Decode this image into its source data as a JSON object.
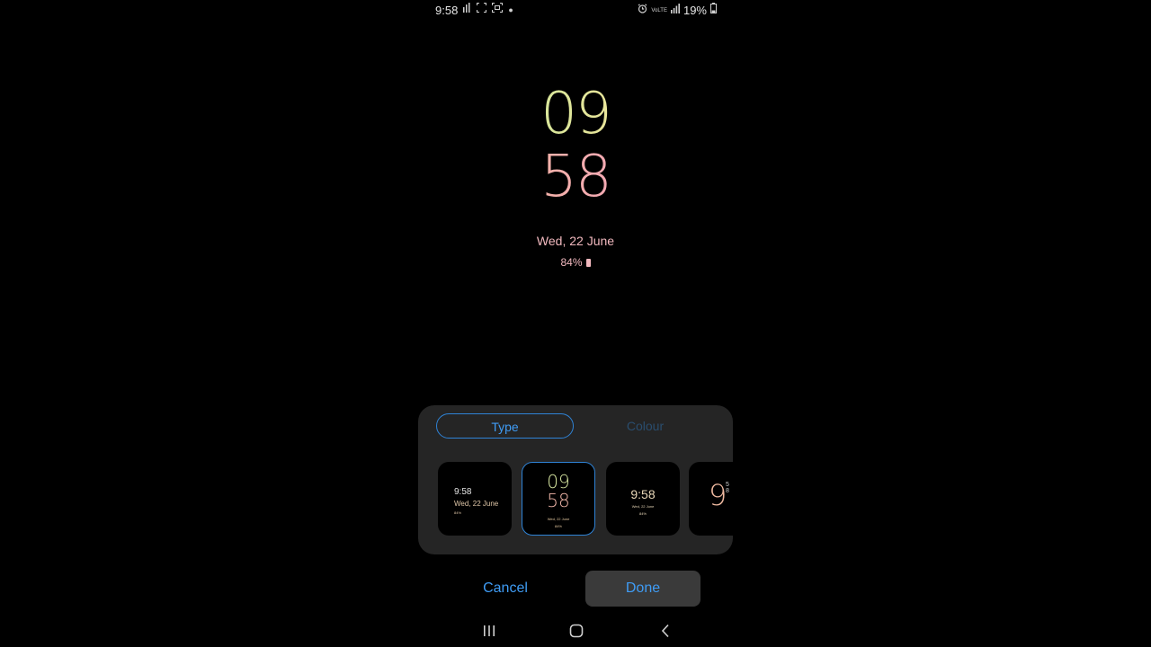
{
  "status_bar": {
    "time": "9:58",
    "battery_percent": "19%",
    "volte_label": "VoLTE",
    "left_icons": [
      "signal-activity-icon",
      "screenshot-corners-icon",
      "screen-capture-icon",
      "notification-dot-icon"
    ],
    "right_icons": [
      "alarm-icon",
      "volte-icon",
      "signal-bars-icon",
      "battery-icon"
    ]
  },
  "clock": {
    "hours": "09",
    "minutes": "58",
    "date": "Wed, 22 June",
    "battery": "84%"
  },
  "panel": {
    "tabs": [
      {
        "label": "Type",
        "selected": true
      },
      {
        "label": "Colour",
        "selected": false
      }
    ],
    "thumbnails": [
      {
        "time": "9:58",
        "date": "Wed, 22 June",
        "battery": "84%"
      },
      {
        "hours": "09",
        "minutes": "58",
        "date": "Wed, 22 June",
        "battery": "84%",
        "selected": true
      },
      {
        "time": "9:58",
        "date": "Wed, 22 June",
        "battery": "84%"
      },
      {
        "big": "9",
        "small": "5 8"
      }
    ]
  },
  "actions": {
    "cancel_label": "Cancel",
    "done_label": "Done"
  },
  "navbar": {
    "items": [
      "recent-apps-icon",
      "home-icon",
      "back-icon"
    ]
  },
  "colors": {
    "accent": "#3f9cf5",
    "panel_bg": "#252525",
    "date_pink": "#f2b9bf"
  }
}
